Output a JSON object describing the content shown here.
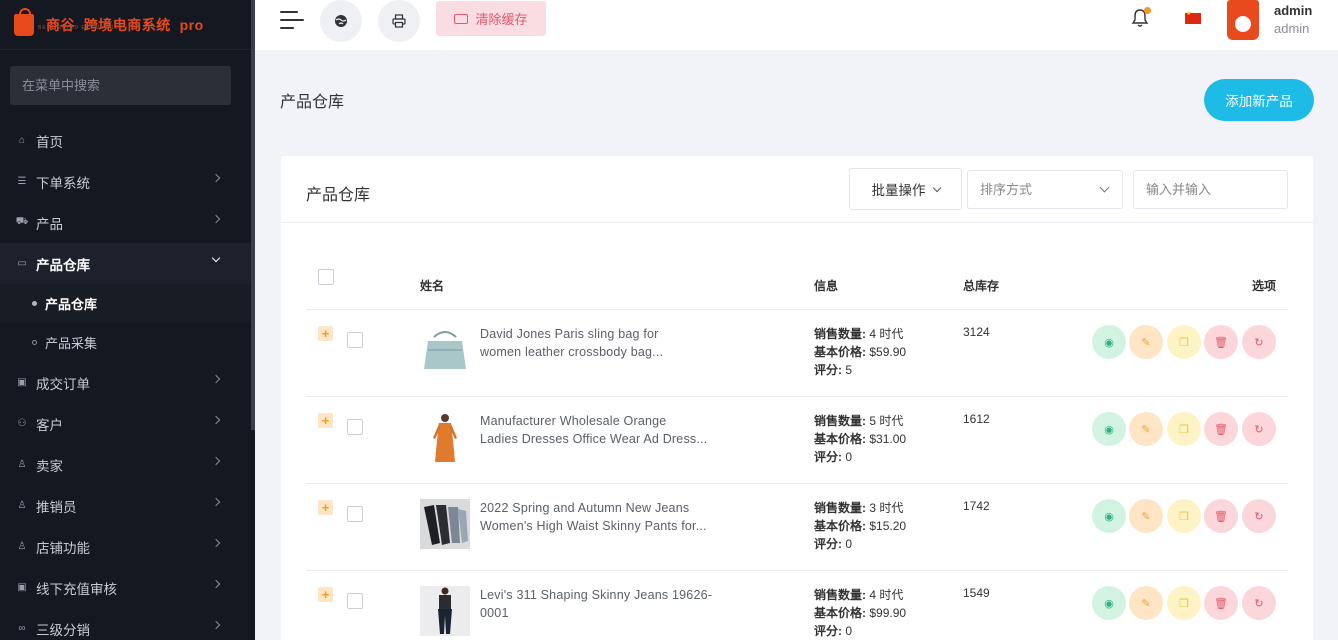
{
  "brand": {
    "name_prefix": "商谷",
    "name_main": "跨境电商系统",
    "name_suffix": "pro",
    "tagline": "BEST RATED ECOMMERCE ITEM"
  },
  "sidebar": {
    "search_placeholder": "在菜单中搜索",
    "items": [
      {
        "label": "首页",
        "icon": "home-icon",
        "has_children": false
      },
      {
        "label": "下单系统",
        "icon": "list-icon",
        "has_children": true
      },
      {
        "label": "产品",
        "icon": "cart-icon",
        "has_children": true
      },
      {
        "label": "产品仓库",
        "icon": "box-icon",
        "has_children": true,
        "expanded": true,
        "children": [
          {
            "label": "产品仓库",
            "current": true
          },
          {
            "label": "产品采集",
            "current": false
          }
        ]
      },
      {
        "label": "成交订单",
        "icon": "money-icon",
        "has_children": true
      },
      {
        "label": "客户",
        "icon": "users-icon",
        "has_children": true
      },
      {
        "label": "卖家",
        "icon": "user-icon",
        "has_children": true
      },
      {
        "label": "推销员",
        "icon": "user-icon",
        "has_children": true
      },
      {
        "label": "店铺功能",
        "icon": "user-icon",
        "has_children": true
      },
      {
        "label": "线下充值审核",
        "icon": "money-icon",
        "has_children": true
      },
      {
        "label": "三级分销",
        "icon": "link-icon",
        "has_children": true
      }
    ]
  },
  "header": {
    "clear_cache_label": "清除缓存",
    "user_name": "admin",
    "user_role": "admin"
  },
  "page": {
    "title": "产品仓库",
    "add_button_label": "添加新产品"
  },
  "card": {
    "title": "产品仓库",
    "bulk_label": "批量操作",
    "sort_placeholder": "排序方式",
    "search_placeholder": "输入并输入"
  },
  "table": {
    "columns": {
      "name": "姓名",
      "info": "信息",
      "stock": "总库存",
      "options": "选项"
    },
    "info_labels": {
      "sales": "销售数量:",
      "price": "基本价格:",
      "rating": "评分:"
    },
    "rows": [
      {
        "name_line1": "David Jones Paris sling bag for",
        "name_line2": "women leather crossbody bag...",
        "sales": "4 时代",
        "price": "$59.90",
        "rating": "5",
        "stock": "3124",
        "thumb": "bag"
      },
      {
        "name_line1": "Manufacturer Wholesale Orange",
        "name_line2": "Ladies Dresses Office Wear Ad Dress...",
        "sales": "5 时代",
        "price": "$31.00",
        "rating": "0",
        "stock": "1612",
        "thumb": "dress"
      },
      {
        "name_line1": "2022 Spring and Autumn New Jeans",
        "name_line2": "Women's High Waist Skinny Pants for...",
        "sales": "3 时代",
        "price": "$15.20",
        "rating": "0",
        "stock": "1742",
        "thumb": "jeans"
      },
      {
        "name_line1": "Levi's 311 Shaping Skinny Jeans 19626-",
        "name_line2": "0001",
        "sales": "4 时代",
        "price": "$99.90",
        "rating": "0",
        "stock": "1549",
        "thumb": "levis"
      }
    ]
  },
  "colors": {
    "sidebar_bg": "#141821",
    "brand_orange": "#e8491d",
    "accent_blue": "#1ebbe7",
    "clear_cache_bg": "#fadde2"
  }
}
